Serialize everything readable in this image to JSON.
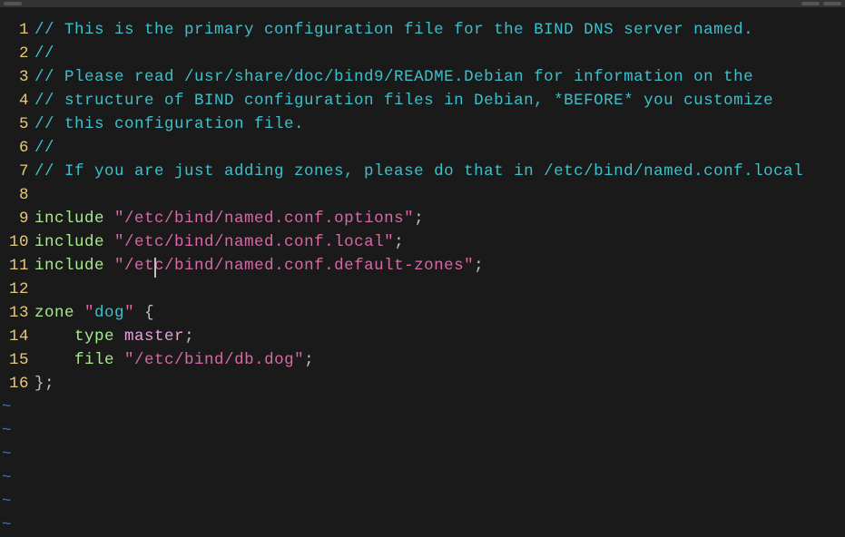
{
  "lines": [
    {
      "n": 1,
      "tokens": [
        {
          "cls": "comment",
          "t": "// This is the primary configuration file for the BIND DNS server named."
        }
      ]
    },
    {
      "n": 2,
      "tokens": [
        {
          "cls": "comment",
          "t": "//"
        }
      ]
    },
    {
      "n": 3,
      "tokens": [
        {
          "cls": "comment",
          "t": "// Please read /usr/share/doc/bind9/README.Debian for information on the"
        }
      ]
    },
    {
      "n": 4,
      "tokens": [
        {
          "cls": "comment",
          "t": "// structure of BIND configuration files in Debian, *BEFORE* you customize"
        }
      ]
    },
    {
      "n": 5,
      "tokens": [
        {
          "cls": "comment",
          "t": "// this configuration file."
        }
      ]
    },
    {
      "n": 6,
      "tokens": [
        {
          "cls": "comment",
          "t": "//"
        }
      ]
    },
    {
      "n": 7,
      "tokens": [
        {
          "cls": "comment",
          "t": "// If you are just adding zones, please do that in /etc/bind/named.conf.local"
        }
      ]
    },
    {
      "n": 8,
      "tokens": []
    },
    {
      "n": 9,
      "tokens": [
        {
          "cls": "keyword",
          "t": "include"
        },
        {
          "cls": "punct",
          "t": " "
        },
        {
          "cls": "string",
          "t": "\"/etc/bind/named.conf.options\""
        },
        {
          "cls": "punct",
          "t": ";"
        }
      ]
    },
    {
      "n": 10,
      "tokens": [
        {
          "cls": "keyword",
          "t": "include"
        },
        {
          "cls": "punct",
          "t": " "
        },
        {
          "cls": "string",
          "t": "\"/etc/bind/named.conf.local\""
        },
        {
          "cls": "punct",
          "t": ";"
        }
      ]
    },
    {
      "n": 11,
      "tokens": [
        {
          "cls": "keyword",
          "t": "include"
        },
        {
          "cls": "punct",
          "t": " "
        },
        {
          "cls": "string",
          "t": "\"/et"
        },
        {
          "cls": "string cursor",
          "t": ""
        },
        {
          "cls": "string",
          "t": "c/bind/named.conf.default-zones\""
        },
        {
          "cls": "punct",
          "t": ";"
        }
      ]
    },
    {
      "n": 12,
      "tokens": []
    },
    {
      "n": 13,
      "tokens": [
        {
          "cls": "keyword",
          "t": "zone"
        },
        {
          "cls": "punct",
          "t": " "
        },
        {
          "cls": "string",
          "t": "\""
        },
        {
          "cls": "zonename",
          "t": "dog"
        },
        {
          "cls": "string",
          "t": "\""
        },
        {
          "cls": "punct",
          "t": " {"
        }
      ]
    },
    {
      "n": 14,
      "tokens": [
        {
          "cls": "punct",
          "t": "    "
        },
        {
          "cls": "keyword",
          "t": "type"
        },
        {
          "cls": "punct",
          "t": " "
        },
        {
          "cls": "ident",
          "t": "master"
        },
        {
          "cls": "punct",
          "t": ";"
        }
      ]
    },
    {
      "n": 15,
      "tokens": [
        {
          "cls": "punct",
          "t": "    "
        },
        {
          "cls": "keyword",
          "t": "file"
        },
        {
          "cls": "punct",
          "t": " "
        },
        {
          "cls": "string",
          "t": "\"/etc/bind/db.dog\""
        },
        {
          "cls": "punct",
          "t": ";"
        }
      ]
    },
    {
      "n": 16,
      "tokens": [
        {
          "cls": "punct",
          "t": "};"
        }
      ]
    }
  ],
  "tilde_count": 6,
  "tilde_char": "~"
}
